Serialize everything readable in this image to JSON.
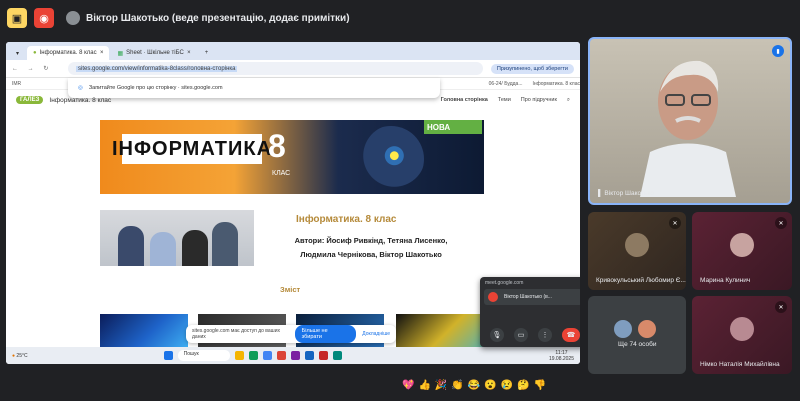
{
  "meet": {
    "presenter_label": "Віктор Шакотько (веде презентацію, додає примітки)",
    "colors": {
      "bg": "#202124",
      "accent": "#8ab4f8",
      "end_call": "#ea4335"
    }
  },
  "browser": {
    "tabs": [
      {
        "label": "Інформатика. 8 клас"
      },
      {
        "label": "Sheet · Шкільне тіБС"
      }
    ],
    "url": "sites.google.com/view/informatika-8class/головна-сторінка",
    "profile_label": "Призупинено, щоб зберегти",
    "bookmarks": [
      "IMR",
      "06-24/ Будда...",
      "Інформатика. 8 клас"
    ],
    "suggestion": "Запитайте Google про цю сторінку · sites.google.com"
  },
  "site": {
    "logo": "ГАЛЕЗ",
    "title": "Інформатика. 8 клас",
    "nav": [
      "Головна сторінка",
      "Теми",
      "Про підручник"
    ],
    "banner": {
      "title": "ІНФОРМАТИКА",
      "grade": "8",
      "klas": "КЛАС",
      "nova": "НОВА"
    },
    "book_title": "Інформатика. 8 клас",
    "authors": "Автори: Йосиф Ривкінд, Тетяна Лисенко, Людмила Чернікова, Віктор Шакотько",
    "contents": "Зміст",
    "cookie_text": "sites.google.com має доступ до ваших даних",
    "cookie_button": "Більше не збирати",
    "cookie_link": "Докладніше"
  },
  "taskbar": {
    "weather": "25°C",
    "search": "Пошук",
    "time": "11:17",
    "date": "19.08.2025"
  },
  "mini_window": {
    "header": "meet.google.com",
    "row": "Віктор Шакотько (в..."
  },
  "participants": {
    "main": "Віктор Шакотько",
    "tiles": [
      {
        "name": "Кривокульський Любомир Є..."
      },
      {
        "name": "Марина Кулинич"
      },
      {
        "name": "Ще 74 особи"
      },
      {
        "name": "Німко Наталія Михайлівна"
      }
    ]
  },
  "reactions": [
    "💖",
    "👍",
    "🎉",
    "👏",
    "😂",
    "😮",
    "😢",
    "🤔",
    "👎"
  ]
}
